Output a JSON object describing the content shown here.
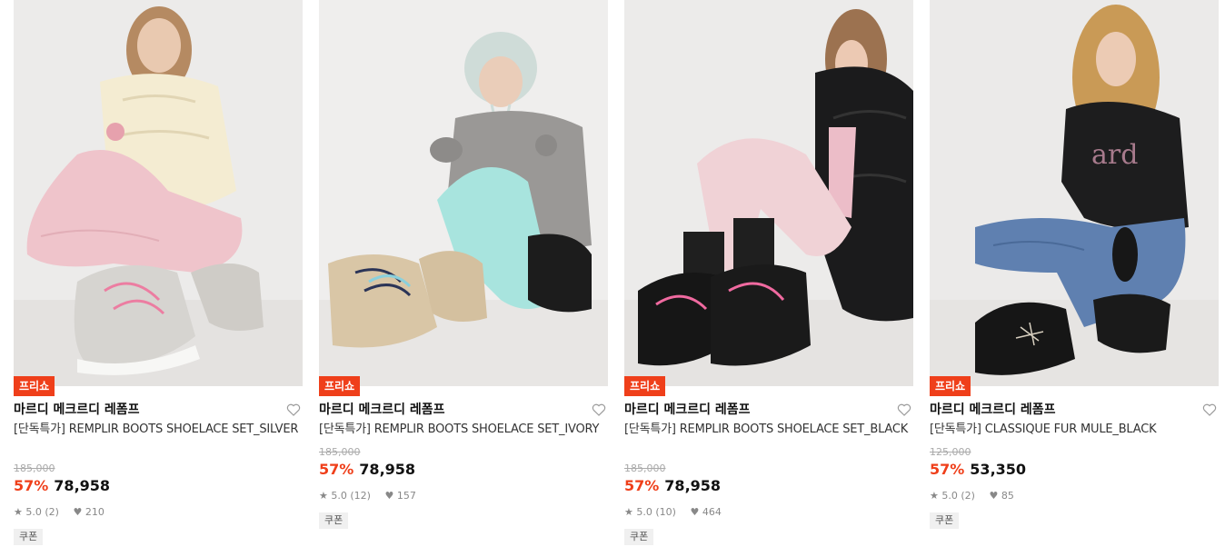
{
  "products": [
    {
      "badge": "프리쇼",
      "brand": "마르디 메크르디 레폼프",
      "name": "[단독특가] REMPLIR BOOTS SHOELACE SET_SILVER",
      "original_price": "185,000",
      "discount": "57%",
      "price": "78,958",
      "rating": "5.0",
      "reviews": "(2)",
      "likes": "210",
      "coupon": "쿠폰",
      "image": "model-silver-boots"
    },
    {
      "badge": "프리쇼",
      "brand": "마르디 메크르디 레폼프",
      "name": "[단독특가] REMPLIR BOOTS SHOELACE SET_IVORY",
      "original_price": "185,000",
      "discount": "57%",
      "price": "78,958",
      "rating": "5.0",
      "reviews": "(12)",
      "likes": "157",
      "coupon": "쿠폰",
      "image": "model-ivory-boots"
    },
    {
      "badge": "프리쇼",
      "brand": "마르디 메크르디 레폼프",
      "name": "[단독특가] REMPLIR BOOTS SHOELACE SET_BLACK",
      "original_price": "185,000",
      "discount": "57%",
      "price": "78,958",
      "rating": "5.0",
      "reviews": "(10)",
      "likes": "464",
      "coupon": "쿠폰",
      "image": "model-black-boots"
    },
    {
      "badge": "프리쇼",
      "brand": "마르디 메크르디 레폼프",
      "name": "[단독특가] CLASSIQUE FUR MULE_BLACK",
      "original_price": "125,000",
      "discount": "57%",
      "price": "53,350",
      "rating": "5.0",
      "reviews": "(2)",
      "likes": "85",
      "coupon": "쿠폰",
      "image": "model-black-mule"
    }
  ],
  "icons": {
    "wishlist": "heart-outline-icon",
    "rating": "star-icon",
    "likes": "heart-filled-icon"
  },
  "colors": {
    "accent": "#ef3f1a",
    "badge_text": "#ffffff",
    "coupon_bg": "#f0f0f0"
  }
}
